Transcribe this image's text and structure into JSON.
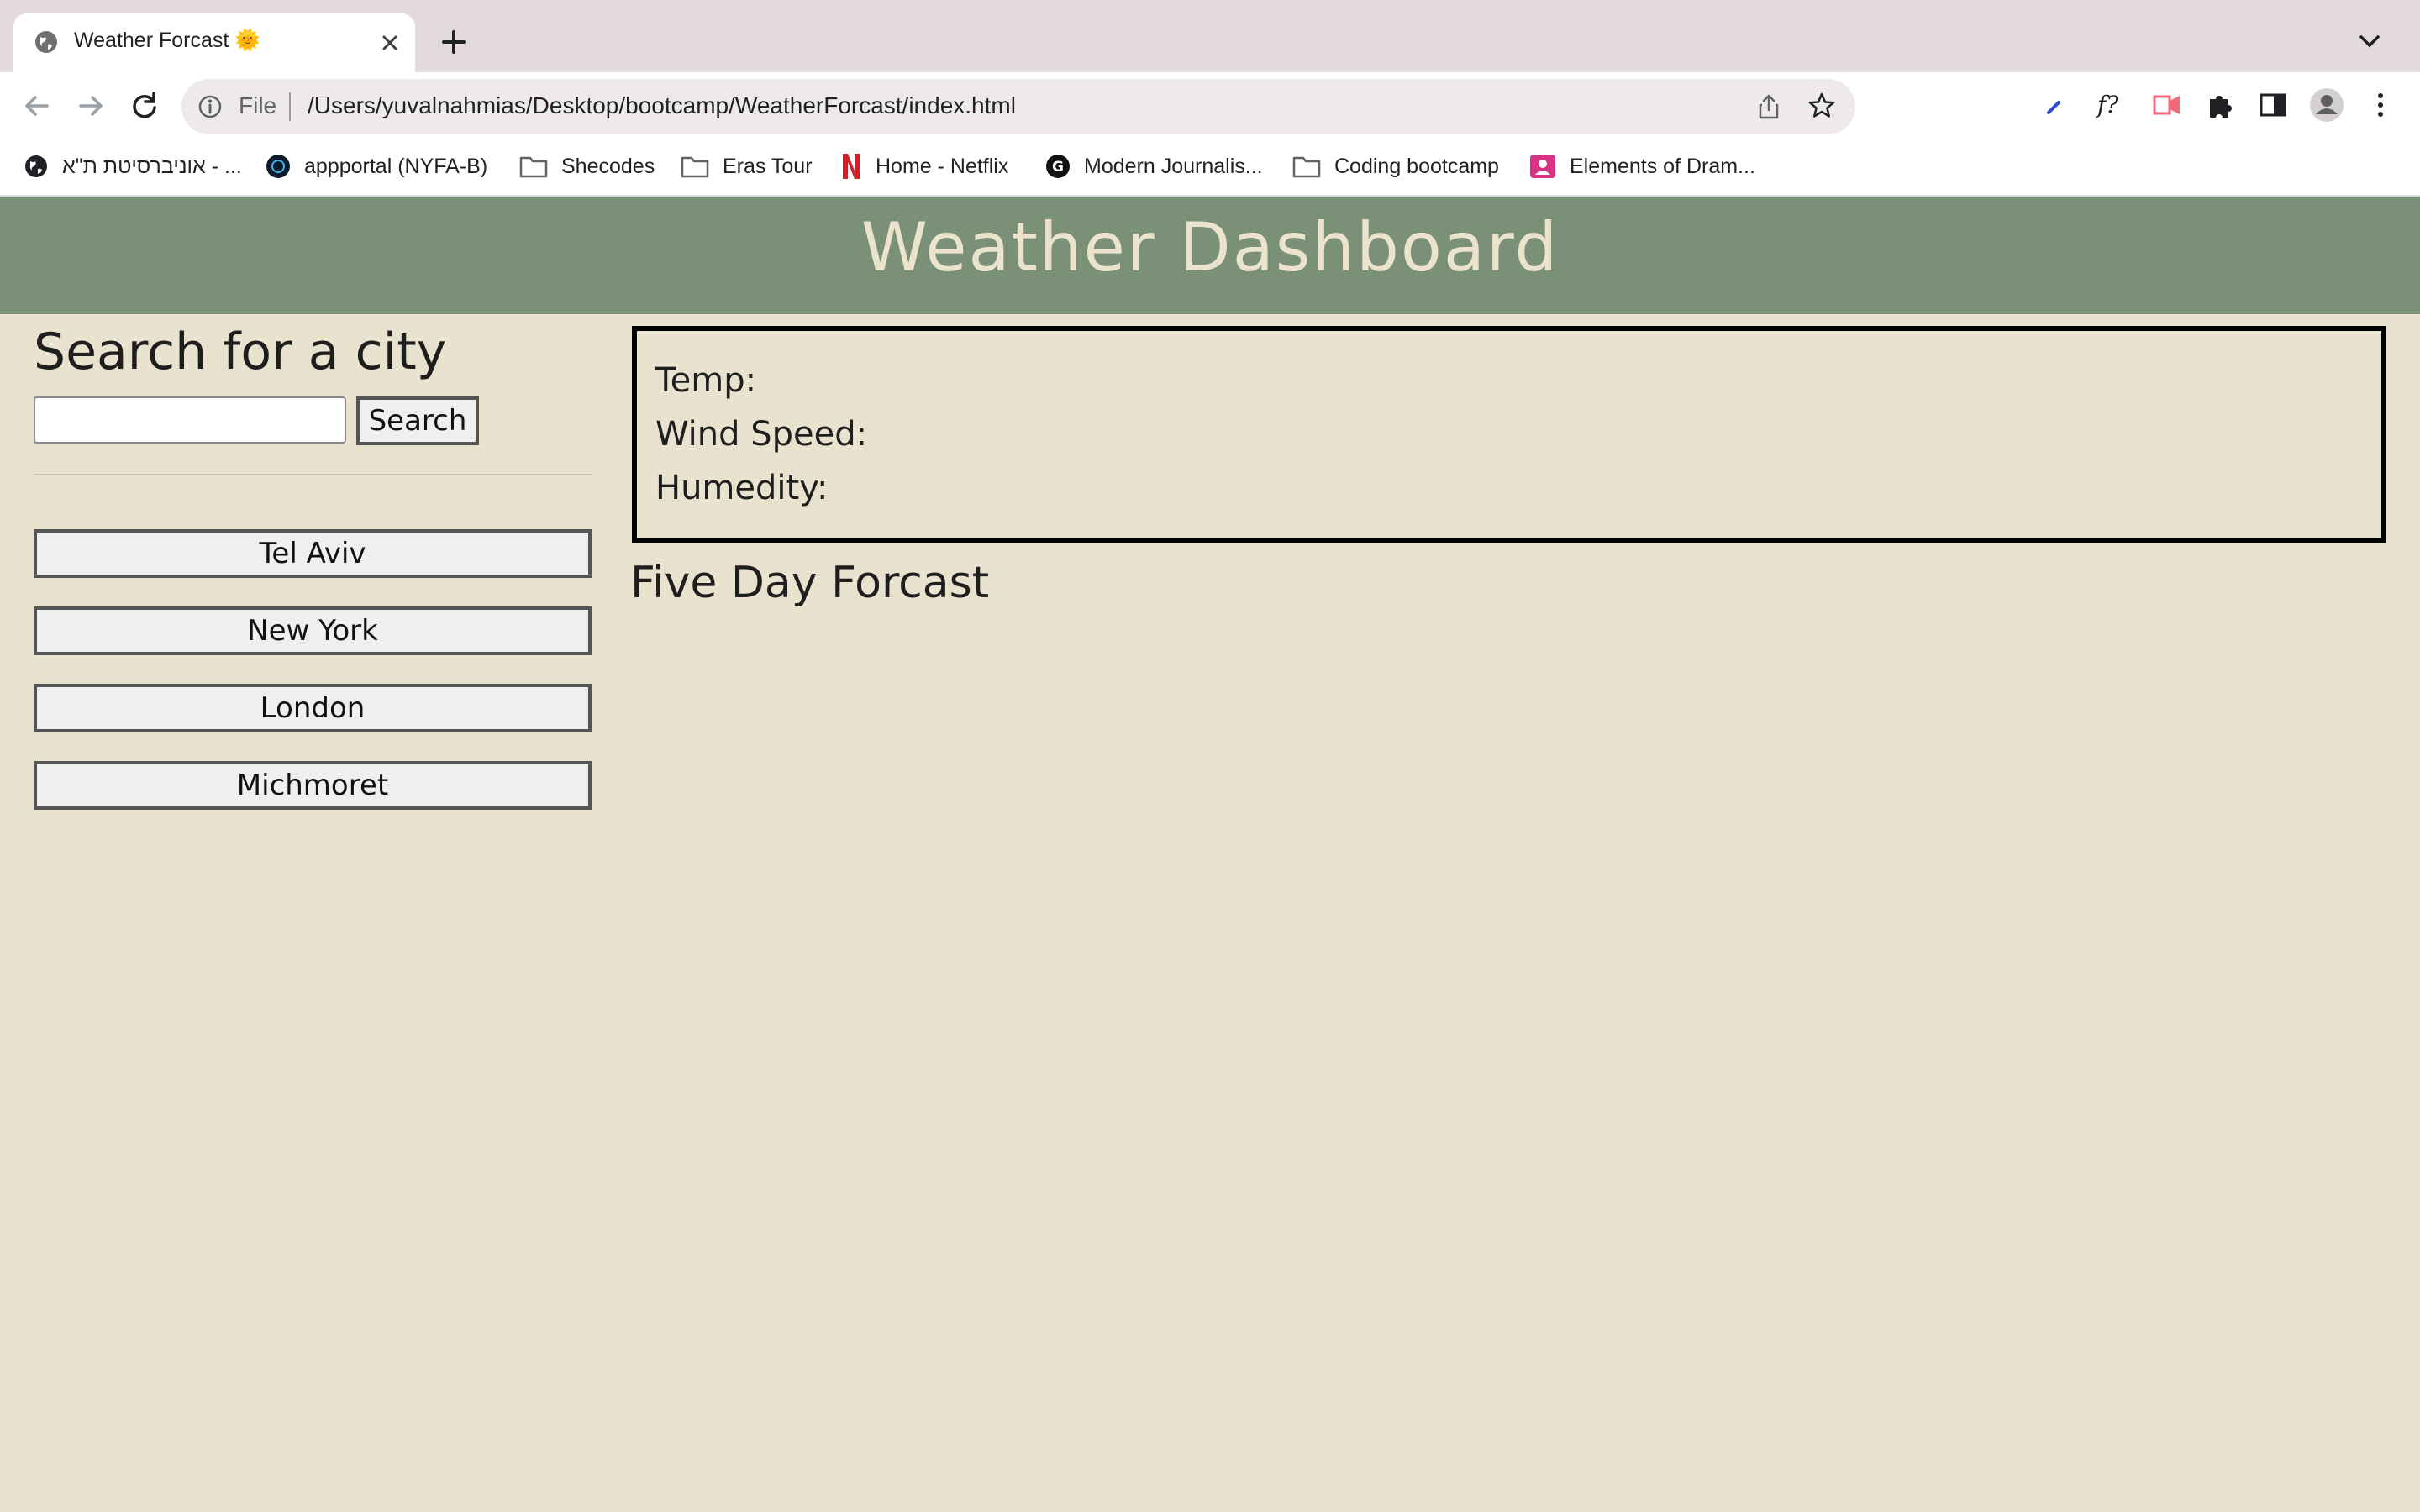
{
  "browser": {
    "tab": {
      "title": "Weather Forcast 🌞"
    },
    "omnibox": {
      "scheme": "File",
      "url": "/Users/yuvalnahmias/Desktop/bootcamp/WeatherForcast/index.html"
    },
    "extensions": [
      "pen-extension-icon",
      "formula-extension-icon",
      "video-extension-icon",
      "puzzle-icon",
      "side-panel-icon",
      "profile-avatar-icon",
      "more-menu-icon"
    ],
    "bookmarks": [
      {
        "label": "אוניברסיטת ת\"א - ...",
        "icon": "globe-icon"
      },
      {
        "label": "appportal (NYFA-B)",
        "icon": "portal-icon"
      },
      {
        "label": "Shecodes",
        "icon": "folder-icon"
      },
      {
        "label": "Eras Tour",
        "icon": "folder-icon"
      },
      {
        "label": "Home - Netflix",
        "icon": "netflix-icon"
      },
      {
        "label": "Modern Journalis...",
        "icon": "g-logo-icon"
      },
      {
        "label": "Coding bootcamp",
        "icon": "folder-icon"
      },
      {
        "label": "Elements of Dram...",
        "icon": "contact-icon"
      }
    ]
  },
  "page": {
    "title": "Weather Dashboard",
    "search": {
      "heading": "Search for a city",
      "input_value": "",
      "button_label": "Search"
    },
    "cities": [
      "Tel Aviv",
      "New York",
      "London",
      "Michmoret"
    ],
    "current": {
      "temp_label": "Temp:",
      "wind_label": "Wind Speed:",
      "humidity_label": "Humedity:"
    },
    "forecast_heading": "Five Day Forcast"
  },
  "colors": {
    "header_bg": "#7a9177",
    "page_bg": "#e9e2ce",
    "title_text": "#ece3cd"
  }
}
